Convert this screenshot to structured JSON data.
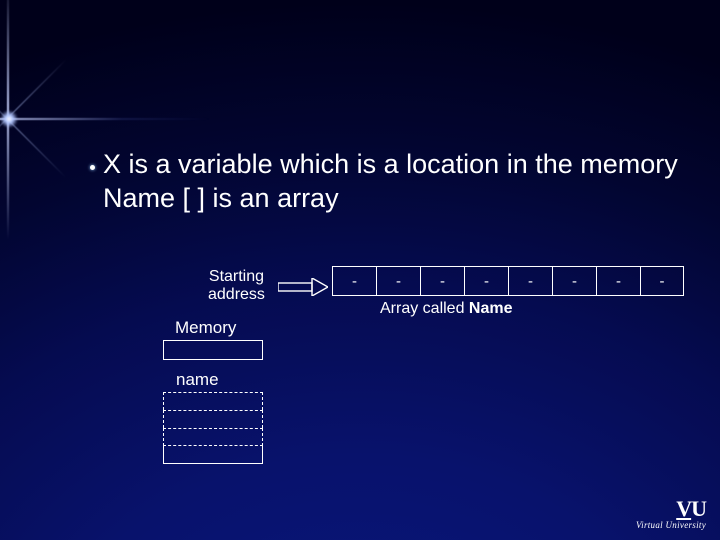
{
  "main_text": "X is a variable which is a location in the memory\nName [ ] is an array",
  "starting_label": "Starting\naddress",
  "array": {
    "cells": [
      "-",
      "-",
      "-",
      "-",
      "-",
      "-",
      "-",
      "-"
    ],
    "caption_prefix": "Array called ",
    "caption_bold": "Name"
  },
  "memory_label": "Memory",
  "name_label": "name",
  "logo": {
    "brand": "VU",
    "sub": "Virtual University"
  },
  "colors": {
    "bg_deep": "#02062e",
    "fg": "#ffffff"
  }
}
